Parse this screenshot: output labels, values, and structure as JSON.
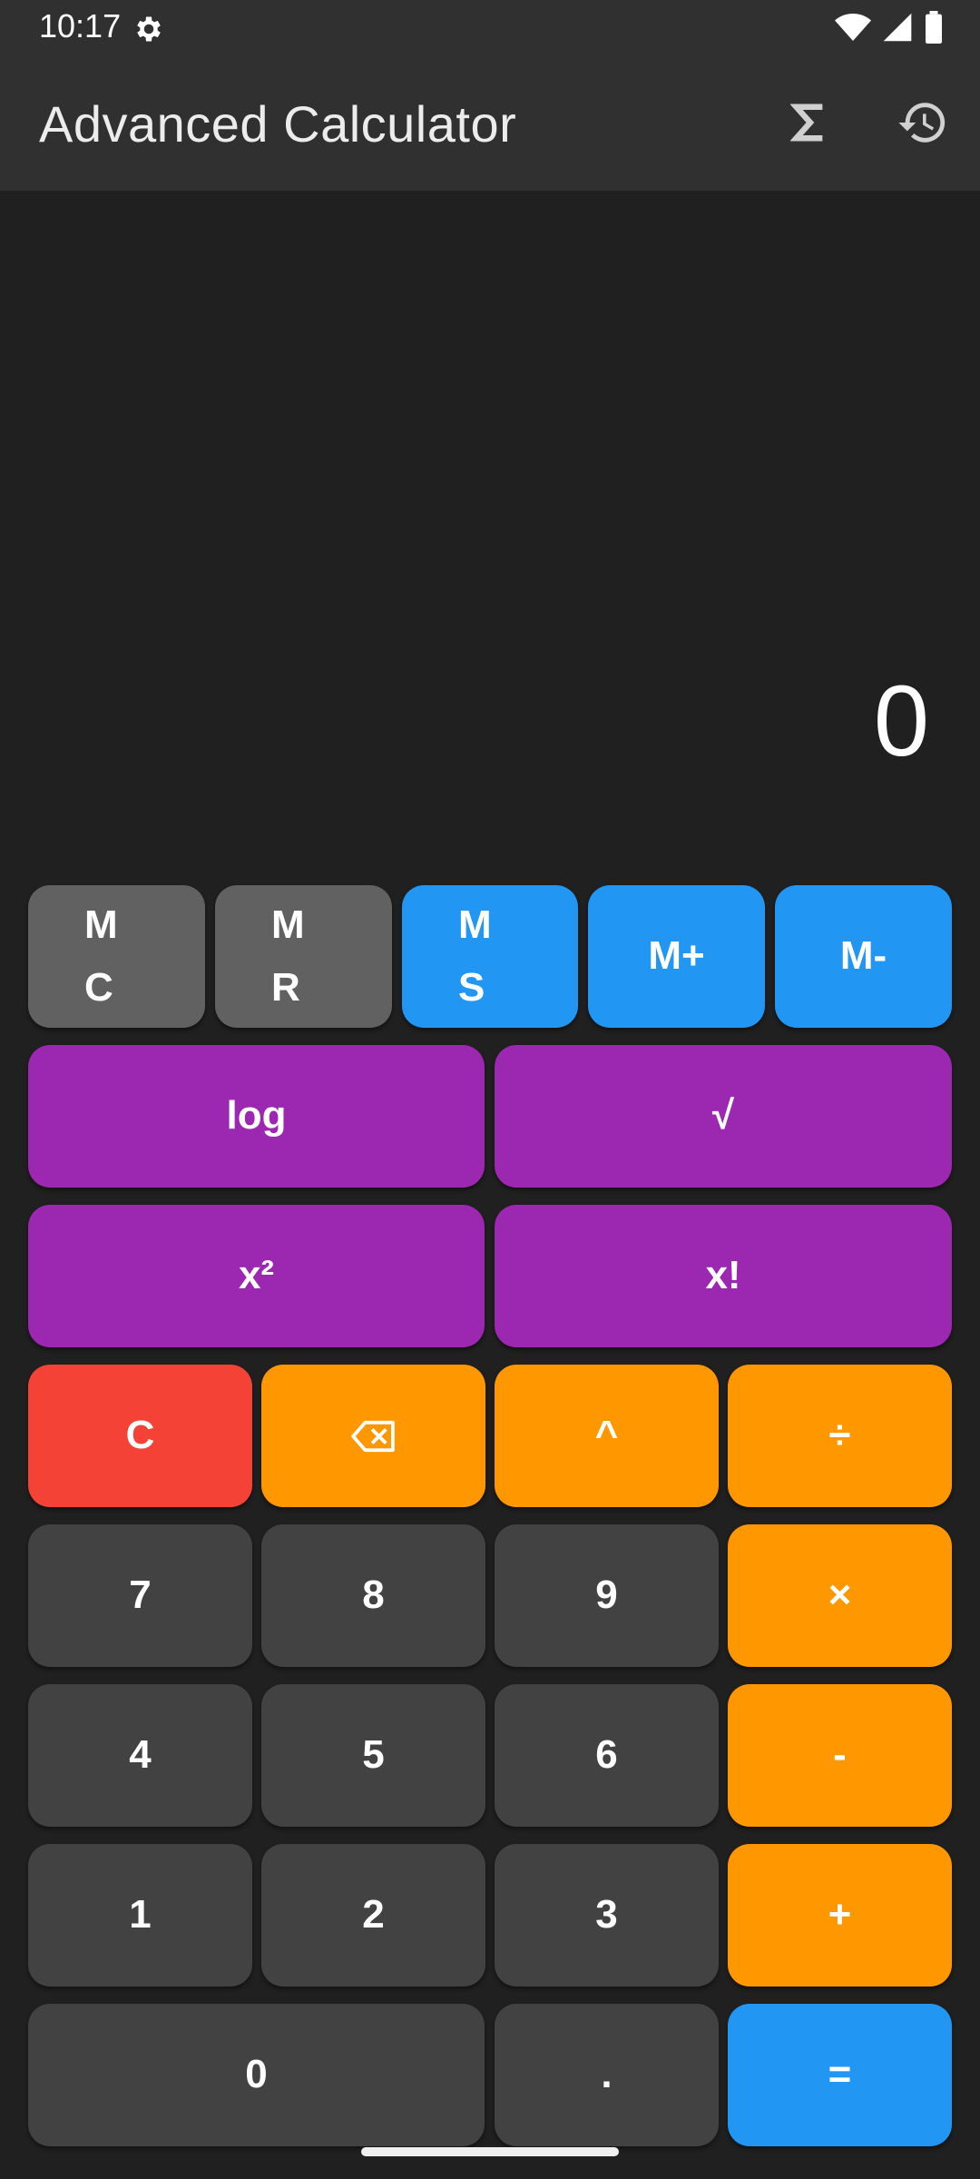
{
  "status_bar": {
    "time": "10:17",
    "icons": [
      "gear-icon",
      "wifi-icon",
      "signal-icon",
      "battery-icon"
    ]
  },
  "app_bar": {
    "title": "Advanced Calculator",
    "actions": [
      "sigma-icon",
      "history-icon"
    ]
  },
  "display": {
    "value": "0"
  },
  "memory_row": [
    {
      "label": "M\nC",
      "color": "#616161"
    },
    {
      "label": "M\nR",
      "color": "#616161"
    },
    {
      "label": "M\nS",
      "color": "#2196f3"
    },
    {
      "label": "M+",
      "color": "#2196f3"
    },
    {
      "label": "M-",
      "color": "#2196f3"
    }
  ],
  "function_rows": [
    [
      {
        "label": "log"
      },
      {
        "label": "√"
      }
    ],
    [
      {
        "label": "x²"
      },
      {
        "label": "x!"
      }
    ]
  ],
  "keys": {
    "clear": "C",
    "backspace": "backspace-icon",
    "power": "^",
    "divide": "÷",
    "seven": "7",
    "eight": "8",
    "nine": "9",
    "multiply": "×",
    "four": "4",
    "five": "5",
    "six": "6",
    "minus": "-",
    "one": "1",
    "two": "2",
    "three": "3",
    "plus": "+",
    "zero": "0",
    "decimal": ".",
    "equals": "="
  },
  "colors": {
    "background": "#202020",
    "bar": "#303030",
    "memory_gray": "#616161",
    "accent_blue": "#2196f3",
    "function_purple": "#9c27b0",
    "clear_red": "#f44336",
    "operator_orange": "#ff9800",
    "digit_dark": "#424242"
  }
}
